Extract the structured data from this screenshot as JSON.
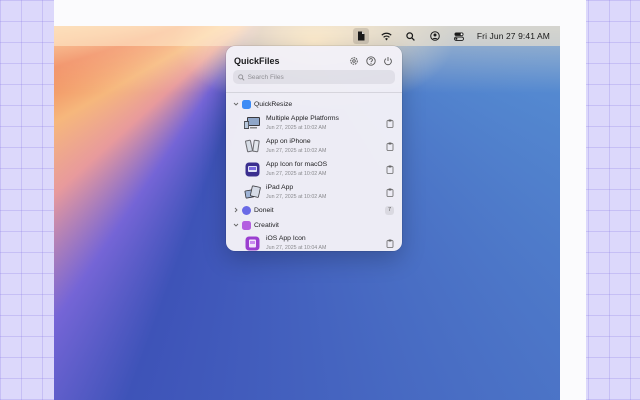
{
  "menubar": {
    "clock": "Fri Jun 27  9:41 AM",
    "icons": [
      "document-icon",
      "wifi-icon",
      "search-icon",
      "user-switch-icon",
      "control-center-icon"
    ]
  },
  "popover": {
    "title": "QuickFiles",
    "search_placeholder": "Search Files",
    "header_icons": [
      "gear-icon",
      "help-icon",
      "power-icon"
    ],
    "groups": [
      {
        "label": "QuickResize",
        "expanded": true,
        "color": "#3d8bf5",
        "files": [
          {
            "name": "Multiple Apple Platforms",
            "date": "Jun 27, 2025 at 10:02 AM",
            "thumb": "devices"
          },
          {
            "name": "App on iPhone",
            "date": "Jun 27, 2025 at 10:02 AM",
            "thumb": "iphones"
          },
          {
            "name": "App Icon for macOS",
            "date": "Jun 27, 2025 at 10:02 AM",
            "thumb": "app-icon"
          },
          {
            "name": "iPad App",
            "date": "Jun 27, 2025 at 10:02 AM",
            "thumb": "ipads"
          }
        ]
      },
      {
        "label": "Doneit",
        "expanded": false,
        "color": "#6a6ae6",
        "count": "7"
      },
      {
        "label": "Creativit",
        "expanded": true,
        "color": "#b35fe0",
        "files": [
          {
            "name": "iOS App Icon",
            "date": "Jun 27, 2025 at 10:04 AM",
            "thumb": "purple-icon"
          }
        ]
      }
    ]
  },
  "colors": {
    "background": "#dcd8fb",
    "accent_blue": "#3d8bf5",
    "accent_purple": "#b35fe0"
  }
}
